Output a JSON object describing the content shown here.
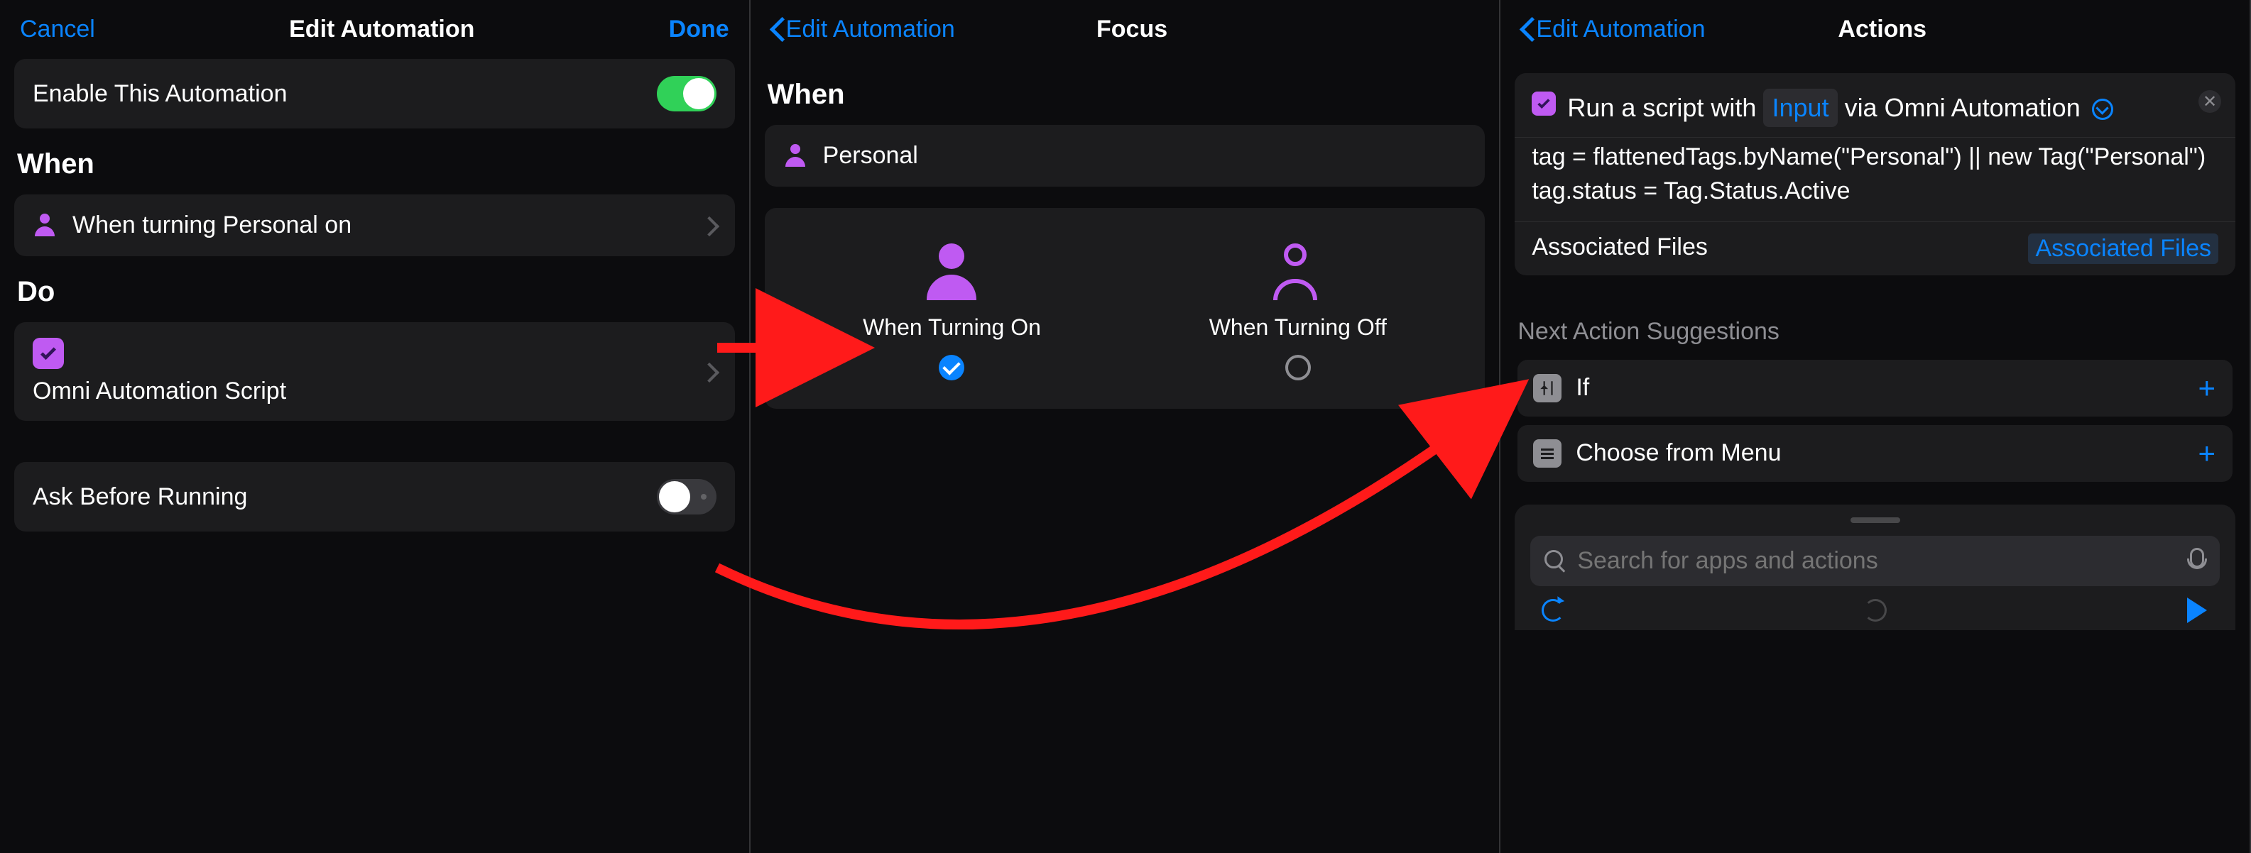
{
  "panel1": {
    "nav": {
      "cancel": "Cancel",
      "title": "Edit Automation",
      "done": "Done"
    },
    "enable_label": "Enable This Automation",
    "when_title": "When",
    "when_row": "When turning Personal on",
    "do_title": "Do",
    "do_row": "Omni Automation Script",
    "ask_label": "Ask Before Running"
  },
  "panel2": {
    "nav_back": "Edit Automation",
    "nav_title": "Focus",
    "when_title": "When",
    "focus_name": "Personal",
    "opt_on": "When Turning On",
    "opt_off": "When Turning Off",
    "selected": "on"
  },
  "panel3": {
    "nav_back": "Edit Automation",
    "nav_title": "Actions",
    "action_prefix": "Run a script with",
    "action_token": "Input",
    "action_suffix": "via Omni Automation",
    "script": "tag = flattenedTags.byName(\"Personal\") || new Tag(\"Personal\")\ntag.status = Tag.Status.Active",
    "assoc_label": "Associated Files",
    "assoc_link": "Associated Files",
    "suggestions_title": "Next Action Suggestions",
    "suggestions": [
      {
        "label": "If",
        "icon": "branch"
      },
      {
        "label": "Choose from Menu",
        "icon": "menu"
      }
    ],
    "search_placeholder": "Search for apps and actions"
  }
}
